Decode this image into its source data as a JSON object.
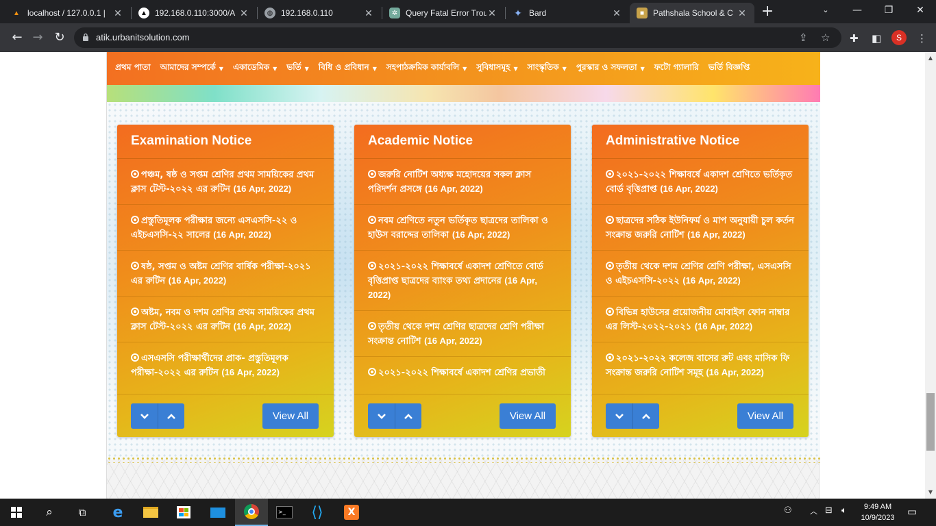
{
  "browser": {
    "tabs": [
      {
        "title": "localhost / 127.0.0.1 |",
        "favicon": "phpmyadmin-icon",
        "color": "#f29111"
      },
      {
        "title": "192.168.0.110:3000/A",
        "favicon": "triangle-icon",
        "color": "#ffffff"
      },
      {
        "title": "192.168.0.110",
        "favicon": "globe-icon",
        "color": "#9aa0a6"
      },
      {
        "title": "Query Fatal Error Trou",
        "favicon": "openai-icon",
        "color": "#74aa9c"
      },
      {
        "title": "Bard",
        "favicon": "sparkle-icon",
        "color": "#8ab4f8"
      },
      {
        "title": "Pathshala School & C",
        "favicon": "school-icon",
        "color": "#c7a24a"
      }
    ],
    "url": "atik.urbanitsolution.com",
    "profile_initial": "S"
  },
  "site": {
    "menu": [
      {
        "label": "প্রথম পাতা",
        "has_caret": false
      },
      {
        "label": "আমাদের সম্পর্কে",
        "has_caret": true
      },
      {
        "label": "একাডেমিক",
        "has_caret": true
      },
      {
        "label": "ভর্তি",
        "has_caret": true
      },
      {
        "label": "বিধি ও প্রবিধান",
        "has_caret": true
      },
      {
        "label": "সহপাঠক্রমিক কার্যাবলি",
        "has_caret": true
      },
      {
        "label": "সুবিধাসমূহ",
        "has_caret": true
      },
      {
        "label": "সাংস্কৃতিক",
        "has_caret": true
      },
      {
        "label": "পুরস্কার ও সফলতা",
        "has_caret": true
      },
      {
        "label": "ফটো গ্যালারি",
        "has_caret": false
      },
      {
        "label": "ভর্তি বিজ্ঞপ্তি",
        "has_caret": false
      }
    ],
    "cards": [
      {
        "title": "Examination Notice",
        "notices": [
          {
            "text": "পঞ্চম, ষষ্ঠ ও সপ্তম শ্রেণির প্রথম সাময়িকের প্রথম ক্লাস টেস্ট-২০২২ এর রুটিন",
            "date": "(16 Apr, 2022)"
          },
          {
            "text": "প্রস্তুতিমূলক পরীক্ষার জন্যে এসএসসি-২২ ও এইচএসসি-২২ সালের",
            "date": "(16 Apr, 2022)"
          },
          {
            "text": "ষষ্ঠ, সপ্তম ও অষ্টম শ্রেণির বার্ষিক পরীক্ষা-২০২১ এর রুটিন",
            "date": "(16 Apr, 2022)"
          },
          {
            "text": "অষ্টম, নবম ও দশম শ্রেণির প্রথম সাময়িকের প্রথম ক্লাস টেস্ট-২০২২ এর রুটিন",
            "date": "(16 Apr, 2022)"
          },
          {
            "text": "এসএসসি পরীক্ষার্থীদের প্রাক- প্রস্তুতিমূলক পরীক্ষা-২০২২ এর রুটিন",
            "date": "(16 Apr, 2022)"
          }
        ],
        "view_all": "View All"
      },
      {
        "title": "Academic Notice",
        "notices": [
          {
            "text": "জরুরি নোটিশ অধ্যক্ষ মহোদয়ের সকল ক্লাস পরিদর্শন প্রসঙ্গে",
            "date": "(16 Apr, 2022)"
          },
          {
            "text": "নবম শ্রেণিতে নতুন ভর্তিকৃত ছাত্রদের তালিকা ও হাউস বরাদ্দের তালিকা",
            "date": "(16 Apr, 2022)"
          },
          {
            "text": "২০২১-২০২২ শিক্ষাবর্ষে একাদশ শ্রেণিতে বোর্ড বৃত্তিপ্রাপ্ত ছাত্রদের ব্যাংক তথ্য প্রদানের",
            "date": "(16 Apr, 2022)"
          },
          {
            "text": "তৃতীয় থেকে দশম শ্রেণির ছাত্রদের শ্রেণি পরীক্ষা সংক্রান্ত নোটিশ",
            "date": "(16 Apr, 2022)"
          },
          {
            "text": "২০২১-২০২২ শিক্ষাবর্ষে একাদশ শ্রেণির প্রভাতী",
            "date": ""
          }
        ],
        "view_all": "View All"
      },
      {
        "title": "Administrative Notice",
        "notices": [
          {
            "text": "২০২১-২০২২ শিক্ষাবর্ষে একাদশ শ্রেণিতে ভর্তিকৃত বোর্ড বৃত্তিপ্রাপ্ত",
            "date": "(16 Apr, 2022)"
          },
          {
            "text": "ছাত্রদের সঠিক ইউনিফর্ম ও মাপ অনুযায়ী চুল কর্তন সংক্রান্ত জরুরি নোটিশ",
            "date": "(16 Apr, 2022)"
          },
          {
            "text": "তৃতীয় থেকে দশম শ্রেণির শ্রেণি পরীক্ষা, এসএসসি ও এইচএসসি-২০২২",
            "date": "(16 Apr, 2022)"
          },
          {
            "text": "বিভিন্ন হাউসের প্রয়োজনীয় মোবাইল ফোন নাম্বার এর লিস্ট-২০২২-২০২১",
            "date": "(16 Apr, 2022)"
          },
          {
            "text": "২০২১-২০২২ কলেজ বাসের রুট এবং মাসিক ফি সংক্রান্ত জরুরি নোটিশ সমূহ",
            "date": "(16 Apr, 2022)"
          }
        ],
        "view_all": "View All"
      }
    ]
  },
  "taskbar": {
    "time": "9:49 AM",
    "date": "10/9/2023"
  },
  "colors": {
    "accent_blue": "#3a7fd5",
    "menu_orange": "#f37021"
  }
}
